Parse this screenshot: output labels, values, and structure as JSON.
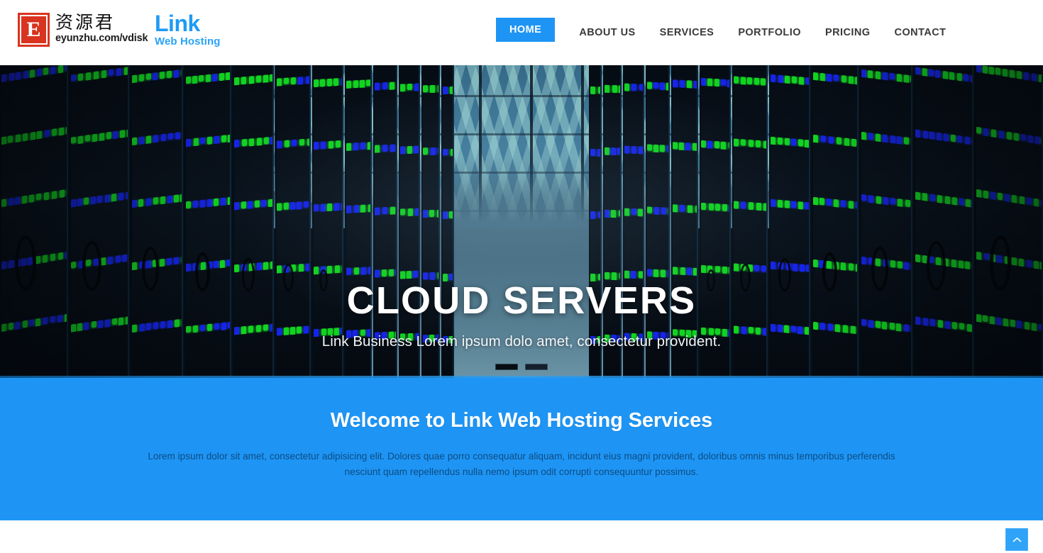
{
  "header": {
    "brand": {
      "mark_letter": "E",
      "name_cn": "资源君",
      "url": "eyunzhu.com/vdisk",
      "icon": "e-logo-icon"
    },
    "logo": {
      "title": "Link",
      "subtitle": "Web Hosting"
    },
    "nav": [
      {
        "label": "HOME",
        "active": true
      },
      {
        "label": "ABOUT US",
        "active": false
      },
      {
        "label": "SERVICES",
        "active": false
      },
      {
        "label": "PORTFOLIO",
        "active": false
      },
      {
        "label": "PRICING",
        "active": false
      },
      {
        "label": "CONTACT",
        "active": false
      }
    ]
  },
  "hero": {
    "title": "CLOUD SERVERS",
    "subtitle": "Link Business Lorem ipsum dolo amet, consectetur provident.",
    "slides": [
      {
        "index": 1,
        "active": true
      },
      {
        "index": 2,
        "active": false
      }
    ],
    "background_alt": "data-center-server-room"
  },
  "welcome": {
    "title": "Welcome to Link Web Hosting Services",
    "body": "Lorem ipsum dolor sit amet, consectetur adipisicing elit. Dolores quae porro consequatur aliquam, incidunt eius magni provident, doloribus omnis minus temporibus perferendis nesciunt quam repellendus nulla nemo ipsum odit corrupti consequuntur possimus."
  },
  "footer": {
    "to_top_icon": "chevron-up-icon"
  },
  "colors": {
    "accent_blue": "#1e95f5",
    "logo_blue": "#1e9bf5",
    "brand_red": "#d8341f",
    "welcome_bg": "#1e95f5",
    "welcome_body_text": "#0d4c82",
    "nav_text": "#3a3a3a",
    "top_btn": "#2ea3f8"
  }
}
